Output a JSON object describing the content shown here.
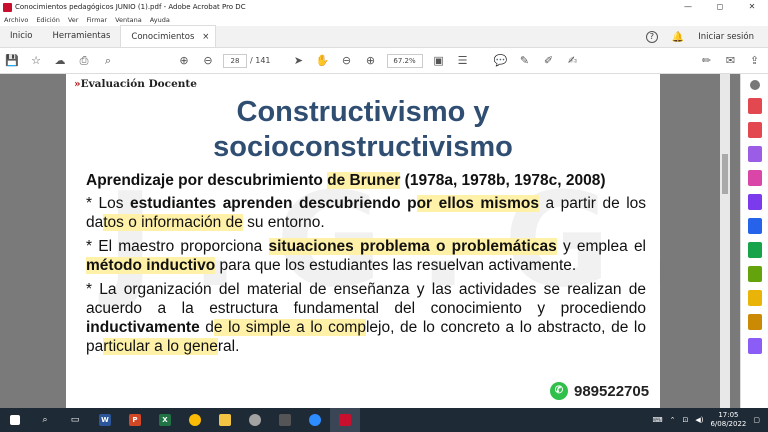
{
  "window": {
    "title": "Conocimientos pedagógicos JUNIO (1).pdf - Adobe Acrobat Pro DC",
    "controls": [
      "—",
      "◻",
      "✕"
    ]
  },
  "menu": [
    "Archivo",
    "Edición",
    "Ver",
    "Firmar",
    "Ventana",
    "Ayuda"
  ],
  "tabs": {
    "home": "Inicio",
    "tools": "Herramientas",
    "doc": "Conocimientos ped...",
    "doc_close": "×",
    "signin": "Iniciar sesión"
  },
  "toolbar": {
    "page_current": "28",
    "page_total": "/ 141",
    "zoom": "67.2%"
  },
  "document": {
    "brand_mark": "»",
    "brand": "Evaluación Docente",
    "title_line1": "Constructivismo y",
    "title_line2": "socioconstructivismo",
    "watermark": "J.G.G.",
    "heading_a": "Aprendizaje por descubrimiento ",
    "heading_b": "de Bruner",
    "heading_c": " (1978a, 1978b, 1978c, 2008)",
    "p1_a": "* Los ",
    "p1_b": "estudiantes aprenden descubriendo p",
    "p1_c": "or ellos mismos",
    "p1_d": " a partir de los da",
    "p1_e": "tos o información de",
    "p1_f": " su ento",
    "p1_g": "rno.",
    "p2_a": "* El maestro proporciona ",
    "p2_b": "situaciones problema o problemáticas",
    "p2_c": " y emplea el ",
    "p2_d": "método inductivo",
    "p2_e": " para que los estudiantes las resuelvan activamente.",
    "p3_a": "*  La organización del material de enseñanza y las actividades se realizan de acuerdo a la estructura fundamental del conocimiento y procediendo ",
    "p3_b": "inductivamente",
    "p3_c": " d",
    "p3_d": "e lo simple a lo comp",
    "p3_e": "lejo, de lo concreto a lo abstracto, de lo pa",
    "p3_f": "rticular a lo gene",
    "p3_g": "ral.",
    "phone": "989522705"
  },
  "taskbar": {
    "time": "17:05",
    "date": "6/08/2022"
  }
}
